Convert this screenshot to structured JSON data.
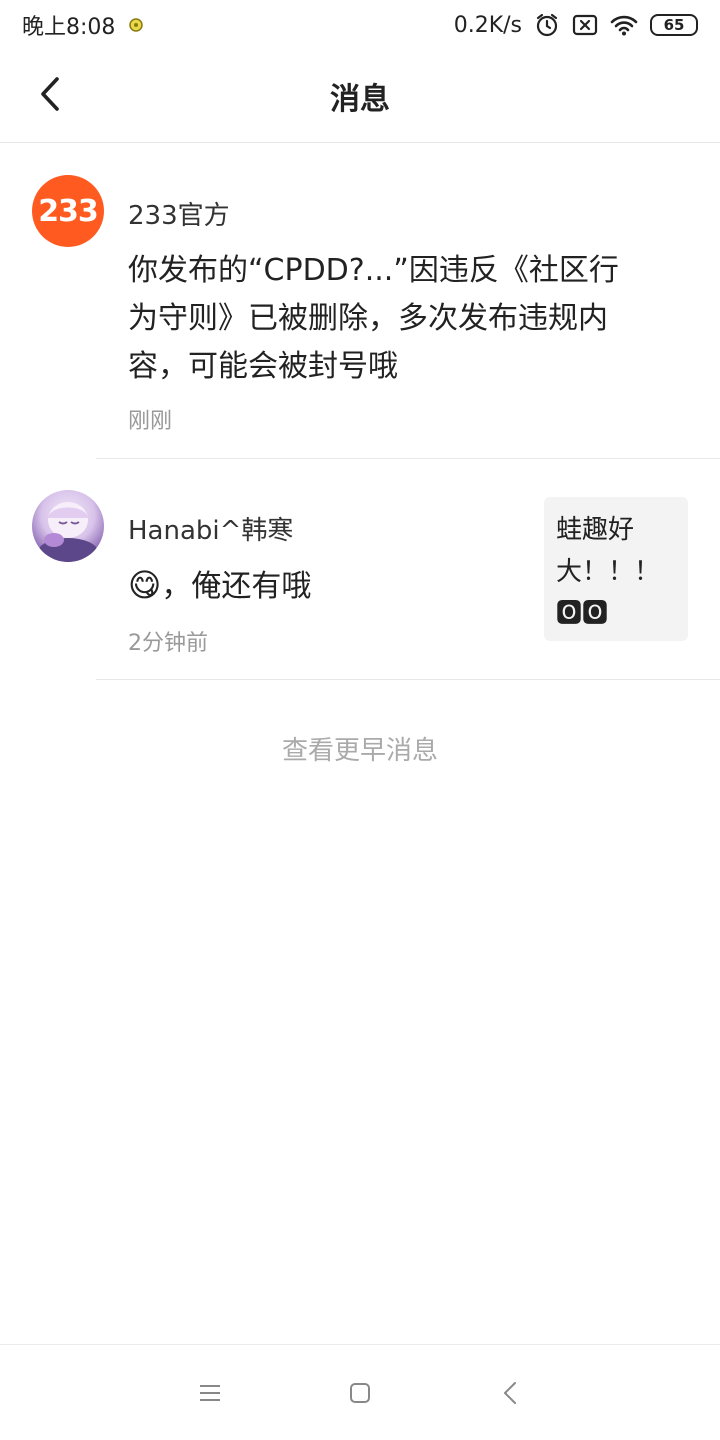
{
  "status_bar": {
    "time": "晚上8:08",
    "network_speed": "0.2K/s",
    "battery": "65",
    "icons": [
      "notification-dot-icon",
      "alarm-icon",
      "sim-x-icon",
      "wifi-icon",
      "battery-icon"
    ]
  },
  "header": {
    "title": "消息",
    "back_icon": "chevron-left-icon"
  },
  "messages": [
    {
      "avatar_text": "233",
      "avatar_color": "#ff5a1f",
      "sender": "233官方",
      "content": "你发布的“CPDD?...”因违反《社区行为守则》已被删除，多次发布违规内容，可能会被封号哦",
      "time": "刚刚"
    },
    {
      "sender": "Hanabi^韩寒",
      "content_emoji": "😋",
      "content_text": "，俺还有哦",
      "time": "2分钟前",
      "quote_line1": "蛙趣好",
      "quote_line2": "大！！！",
      "quote_emoji": "🅾🅾"
    }
  ],
  "more_link": "查看更早消息",
  "nav_bar": {
    "icons": [
      "menu-icon",
      "home-square-icon",
      "back-triangle-icon"
    ]
  }
}
